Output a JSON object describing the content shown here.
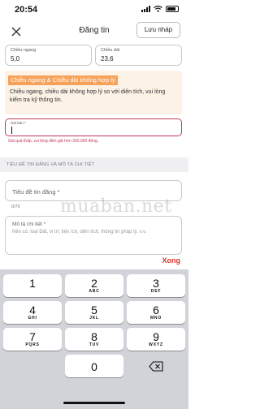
{
  "status_bar": {
    "time": "20:54"
  },
  "header": {
    "title": "Đăng tin",
    "save_draft": "Lưu nháp"
  },
  "width_field": {
    "label": "Chiều ngang",
    "value": "5,0"
  },
  "length_field": {
    "label": "Chiều dài",
    "value": "23,6"
  },
  "warning": {
    "title": "Chiều ngang & Chiều dài không hợp lý",
    "message": "Chiều ngang, chiều dài không hợp lý so với diện tích, vui lòng kiểm tra kỹ thông tin."
  },
  "price_field": {
    "label": "Giá bán *",
    "error": "Giá quá thấp, vui lòng điền giá hơn 350.000 đồng."
  },
  "section": {
    "title": "TIÊU ĐỀ TIN ĐĂNG VÀ MÔ TẢ CHI TIẾT"
  },
  "title_input": {
    "placeholder": "Tiêu đề tin đăng *",
    "counter": "0/70"
  },
  "description_input": {
    "label": "Mô tả chi tiết *",
    "placeholder": "Nên có: loại Đất, vị trí, tiện ích, diện tích, thông tin pháp lý, v.v."
  },
  "watermark": "muaban.net",
  "keyboard": {
    "done": "Xong",
    "keys": [
      {
        "digit": "1",
        "letters": ""
      },
      {
        "digit": "2",
        "letters": "ABC"
      },
      {
        "digit": "3",
        "letters": "DEF"
      },
      {
        "digit": "4",
        "letters": "GHI"
      },
      {
        "digit": "5",
        "letters": "JKL"
      },
      {
        "digit": "6",
        "letters": "MNO"
      },
      {
        "digit": "7",
        "letters": "PQRS"
      },
      {
        "digit": "8",
        "letters": "TUV"
      },
      {
        "digit": "9",
        "letters": "WXYZ"
      },
      {
        "digit": "0",
        "letters": ""
      }
    ]
  }
}
